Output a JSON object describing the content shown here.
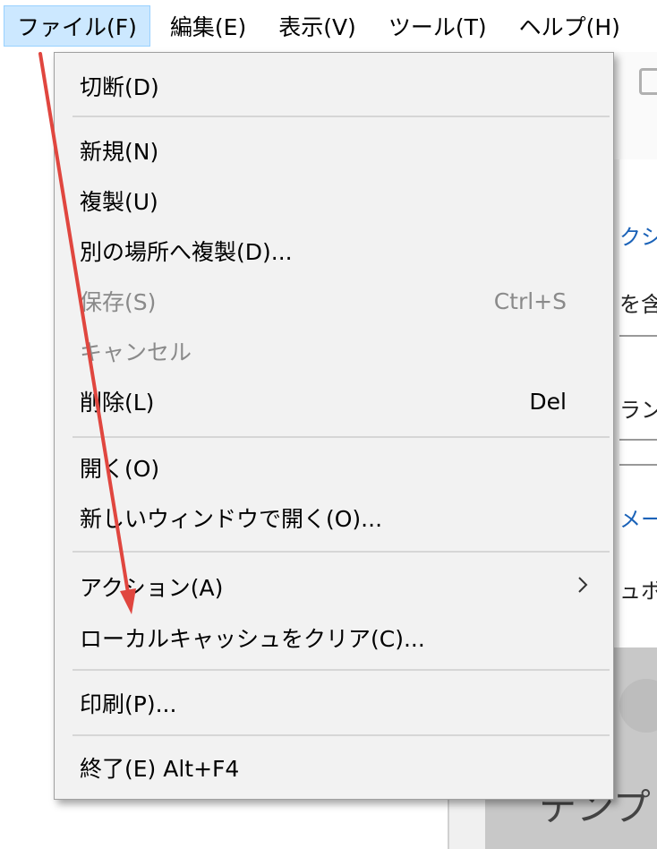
{
  "menubar": {
    "items": [
      "ファイル(F)",
      "編集(E)",
      "表示(V)",
      "ツール(T)",
      "ヘルプ(H)"
    ]
  },
  "background_window": {
    "fragments": [
      "クショ",
      "を含",
      "ラン",
      "メー",
      "ュボ",
      "テンプ"
    ]
  },
  "file_menu": {
    "disconnect": "切断(D)",
    "new": "新規(N)",
    "duplicate": "複製(U)",
    "duplicate_elsewhere": "別の場所へ複製(D)...",
    "save": "保存(S)",
    "save_shortcut": "Ctrl+S",
    "cancel": "キャンセル",
    "delete": "削除(L)",
    "delete_shortcut": "Del",
    "open": "開く(O)",
    "open_new_window": "新しいウィンドウで開く(O)...",
    "actions": "アクション(A)",
    "clear_cache": "ローカルキャッシュをクリア(C)...",
    "print": "印刷(P)...",
    "exit": "終了(E)  Alt+F4"
  },
  "colors": {
    "menubar_highlight": "#cce8ff",
    "menu_background": "#f2f2f2",
    "annotation_arrow": "#e0463f"
  }
}
